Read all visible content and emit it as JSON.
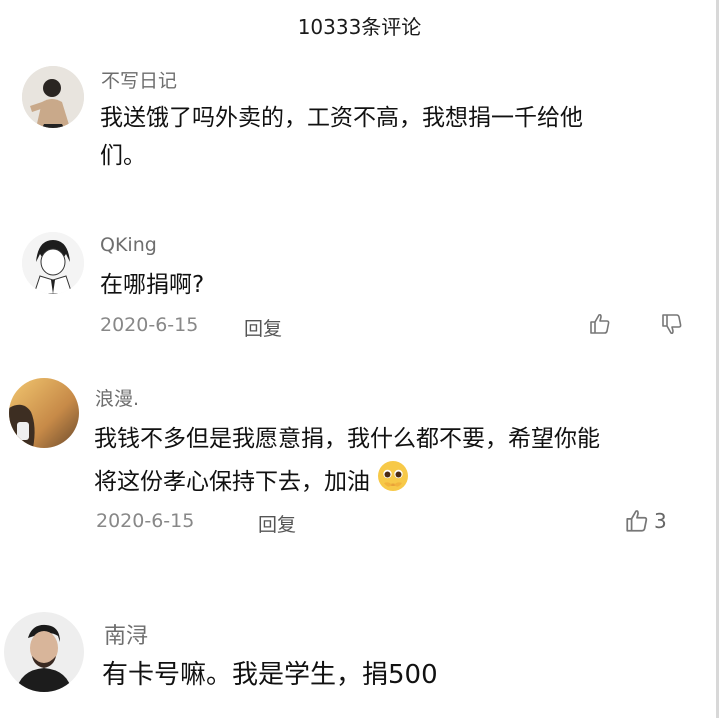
{
  "header": {
    "title": "10333条评论"
  },
  "comments": [
    {
      "username": "不写日记",
      "text_line1": "我送饿了吗外卖的，工资不高，我想捐一千给他",
      "text_line2": "们。"
    },
    {
      "username": "QKing",
      "text_line1": "在哪捐啊?",
      "date": "2020-6-15",
      "reply_label": "回复"
    },
    {
      "username": "浪漫.",
      "text_line1": "我钱不多但是我愿意捐，我什么都不要，希望你能",
      "text_line2": "将这份孝心保持下去，加油",
      "date": "2020-6-15",
      "reply_label": "回复",
      "like_count": "3"
    },
    {
      "username": "南浔",
      "text_line1": "有卡号嘛。我是学生，捐500"
    }
  ],
  "icons": {
    "like": "thumbs-up-icon",
    "dislike": "thumbs-down-icon",
    "emoji": "pleading-face-emoji-icon"
  },
  "colors": {
    "username": "#6e6e6e",
    "meta": "#888888",
    "text": "#111111"
  }
}
